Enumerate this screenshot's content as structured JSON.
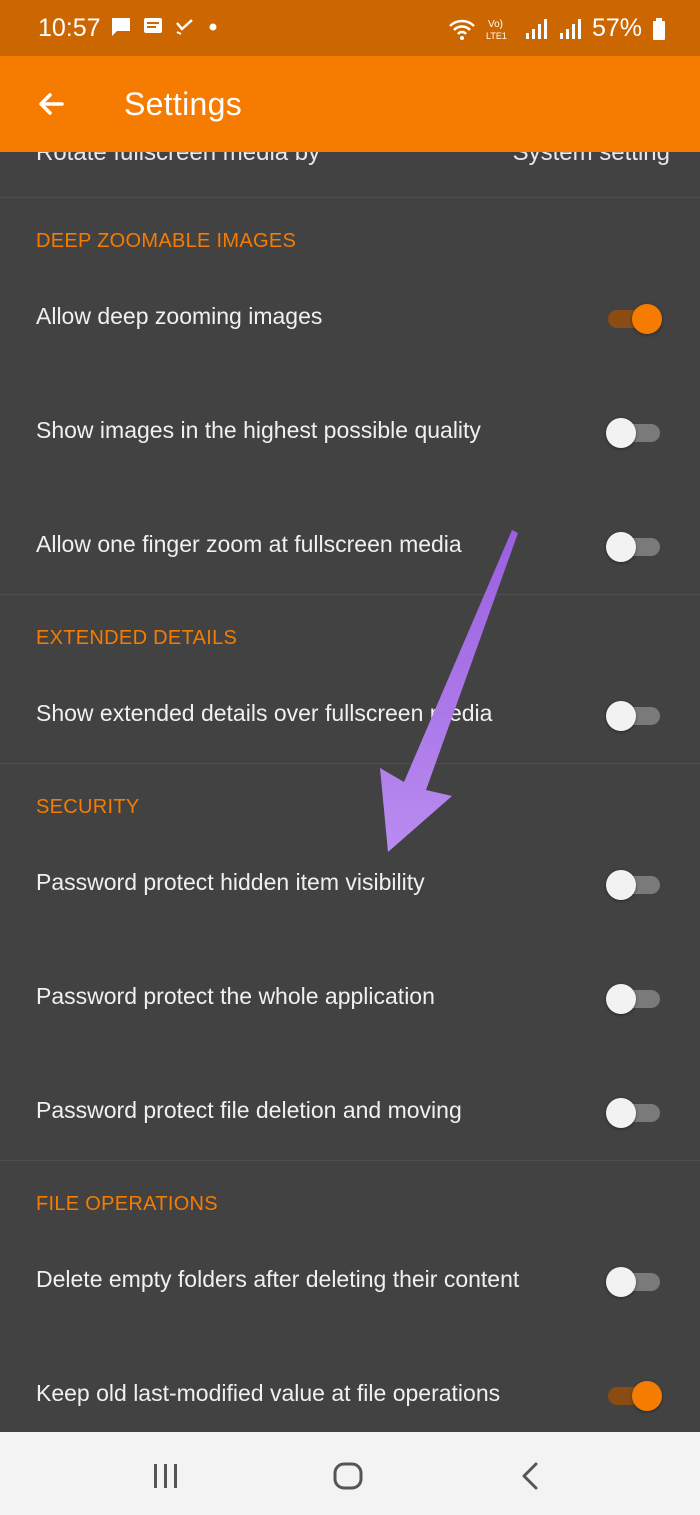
{
  "status_bar": {
    "time": "10:57",
    "battery": "57%",
    "notification_icons": [
      "chat-bubble-icon",
      "message-icon",
      "check-icon",
      "dot-icon"
    ],
    "system_icons": [
      "wifi-icon",
      "volte-icon",
      "signal-icon",
      "signal-icon",
      "battery-icon"
    ]
  },
  "app_bar": {
    "title": "Settings",
    "back_icon": "arrow-back-icon",
    "background": "#f57c00"
  },
  "partial_row": {
    "label": "Rotate fullscreen media by",
    "value": "System setting"
  },
  "sections": [
    {
      "header": "DEEP ZOOMABLE IMAGES",
      "items": [
        {
          "label": "Allow deep zooming images",
          "on": true
        },
        {
          "label": "Show images in the highest possible quality",
          "on": false
        },
        {
          "label": "Allow one finger zoom at fullscreen media",
          "on": false
        }
      ]
    },
    {
      "header": "EXTENDED DETAILS",
      "items": [
        {
          "label": "Show extended details over fullscreen media",
          "on": false
        }
      ]
    },
    {
      "header": "SECURITY",
      "items": [
        {
          "label": "Password protect hidden item visibility",
          "on": false
        },
        {
          "label": "Password protect the whole application",
          "on": false
        },
        {
          "label": "Password protect file deletion and moving",
          "on": false
        }
      ]
    },
    {
      "header": "FILE OPERATIONS",
      "items": [
        {
          "label": "Delete empty folders after deleting their content",
          "on": false
        },
        {
          "label": "Keep old last-modified value at file operations",
          "on": true
        }
      ]
    }
  ],
  "nav_bar": {
    "buttons": [
      "recents-icon",
      "home-icon",
      "back-icon"
    ]
  },
  "colors": {
    "accent": "#f57c00",
    "status_bar": "#cc6600",
    "background": "#424242",
    "annotation_arrow": "#a874e8"
  }
}
